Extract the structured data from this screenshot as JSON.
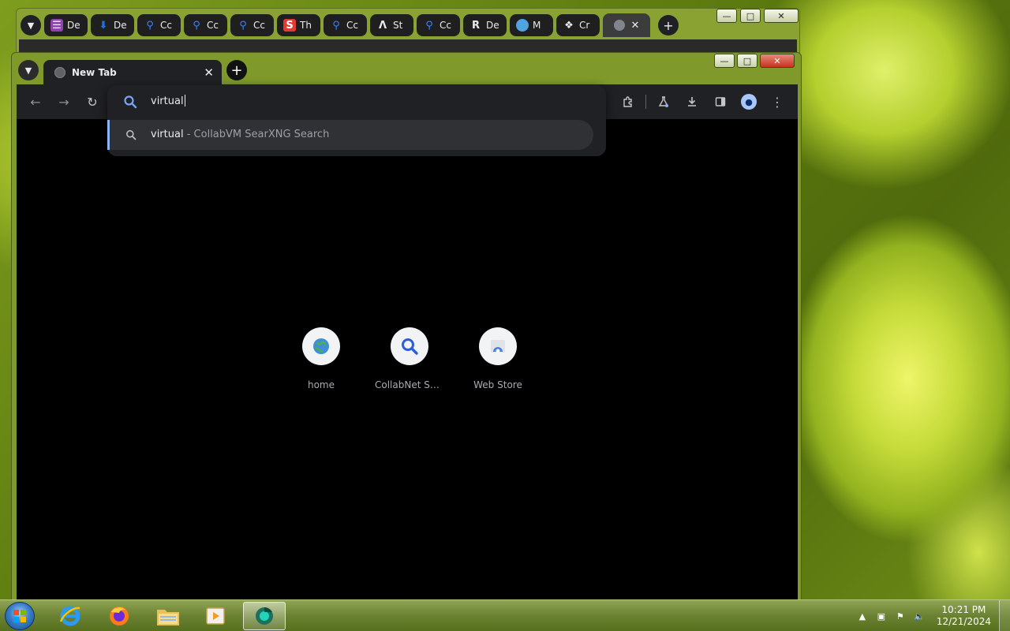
{
  "background_window": {
    "tabs": [
      {
        "label": "De",
        "favicon": "app-icon",
        "color": "#8e44ad"
      },
      {
        "label": "De",
        "favicon": "download-icon",
        "color": "#1a73e8"
      },
      {
        "label": "Cc",
        "favicon": "search-icon",
        "color": "#3b82f6"
      },
      {
        "label": "Cc",
        "favicon": "search-icon",
        "color": "#3b82f6"
      },
      {
        "label": "Cc",
        "favicon": "search-icon",
        "color": "#3b82f6"
      },
      {
        "label": "Th",
        "favicon": "s-logo-icon",
        "color": "#e53935"
      },
      {
        "label": "Cc",
        "favicon": "search-icon",
        "color": "#3b82f6"
      },
      {
        "label": "St",
        "favicon": "lambda-icon",
        "color": "#e8eaed"
      },
      {
        "label": "Cc",
        "favicon": "search-icon",
        "color": "#3b82f6"
      },
      {
        "label": "De",
        "favicon": "r-logo-icon",
        "color": "#e8eaed"
      },
      {
        "label": "M",
        "favicon": "globe-icon",
        "color": "#4fa3e0"
      },
      {
        "label": "Cr",
        "favicon": "puzzle-icon",
        "color": "#e8eaed"
      }
    ]
  },
  "window": {
    "active_tab": {
      "title": "New Tab"
    }
  },
  "omnibox": {
    "query": "virtual",
    "suggestion": {
      "term": "virtual",
      "separator": " - ",
      "engine": "CollabVM SearXNG Search"
    }
  },
  "shortcuts": [
    {
      "label": "home",
      "icon": "globe-icon"
    },
    {
      "label": "CollabNet Se...",
      "icon": "search-icon"
    },
    {
      "label": "Web Store",
      "icon": "web-store-icon"
    }
  ],
  "taskbar": {
    "time": "10:21 PM",
    "date": "12/21/2024"
  },
  "colors": {
    "accent": "#8ab4f8",
    "toolbar": "#202124",
    "suggestion_bg": "#303134"
  }
}
